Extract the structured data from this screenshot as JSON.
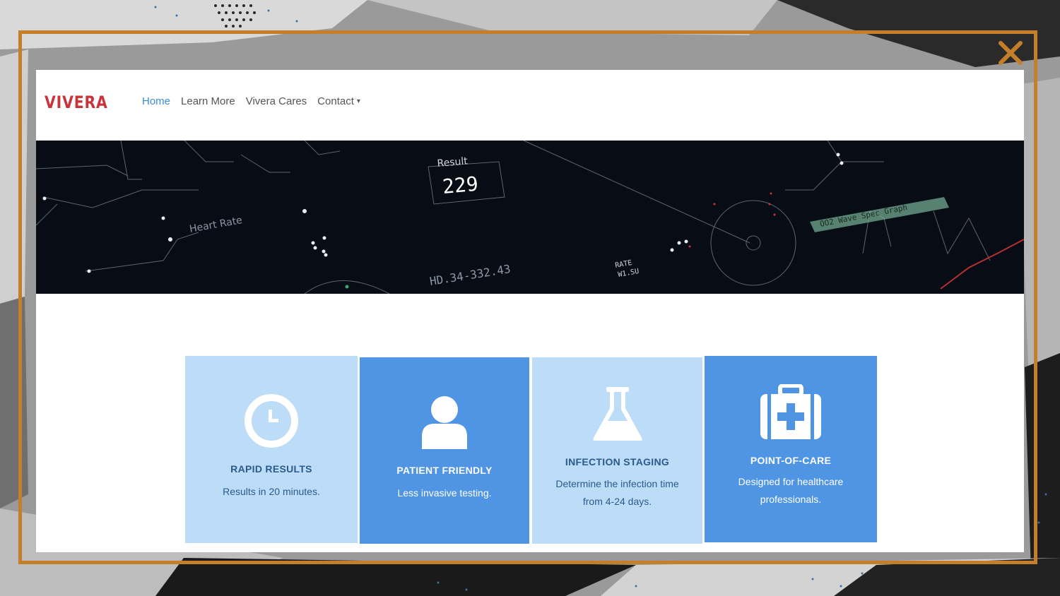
{
  "close_icon": "close-x-icon",
  "brand": {
    "name": "VIVERA",
    "color": "#c9343a"
  },
  "nav": {
    "items": [
      {
        "label": "Home",
        "active": true
      },
      {
        "label": "Learn More",
        "active": false
      },
      {
        "label": "Vivera Cares",
        "active": false
      },
      {
        "label": "Contact",
        "active": false,
        "has_dropdown": true
      }
    ]
  },
  "hero": {
    "labels": {
      "result_title": "Result",
      "result_value": "229",
      "heart_rate": "Heart Rate",
      "code": "HD.34-332.43",
      "rate": "RATE",
      "rate_value": "W1.SU",
      "graph": "OO2 Wave Spec Graph"
    }
  },
  "features": [
    {
      "icon": "clock-icon",
      "title": "RAPID RESULTS",
      "desc": "Results in 20 minutes.",
      "style": "light"
    },
    {
      "icon": "user-icon",
      "title": "PATIENT FRIENDLY",
      "desc": "Less invasive testing.",
      "style": "dark"
    },
    {
      "icon": "flask-icon",
      "title": "INFECTION STAGING",
      "desc": "Determine the infection time from 4-24 days.",
      "style": "light"
    },
    {
      "icon": "medical-kit-icon",
      "title": "POINT-OF-CARE",
      "desc": "Designed for healthcare professionals.",
      "style": "dark"
    }
  ],
  "colors": {
    "frame": "#c37f2a",
    "link_active": "#3a8ed6",
    "card_light": "#bcdcf7",
    "card_dark": "#5095e4"
  }
}
